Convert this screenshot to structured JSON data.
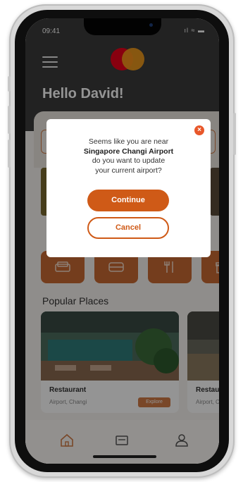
{
  "status_bar": {
    "time": "09:41",
    "icons": "ıl ≈ ▬"
  },
  "header": {
    "greeting": "Hello David!"
  },
  "section": {
    "title": "Popular Places"
  },
  "cards": [
    {
      "title": "Restaurant",
      "subtitle": "Airport, Changi",
      "badge": "Explore"
    },
    {
      "title": "Restaurant",
      "subtitle": "Airport, C..."
    }
  ],
  "dialog": {
    "line1": "Seems like you are near",
    "airport": "Singapore Changi Airport",
    "line3": "do you want to update",
    "line4": "your current airport?",
    "continue_label": "Continue",
    "cancel_label": "Cancel",
    "close_symbol": "×"
  },
  "tabs": [
    {
      "icon": "home-icon"
    },
    {
      "icon": "card-icon"
    },
    {
      "icon": "profile-icon"
    }
  ],
  "colors": {
    "accent": "#cf5a17",
    "header_bg": "#3b3b3b",
    "close_button": "#e8572a"
  }
}
